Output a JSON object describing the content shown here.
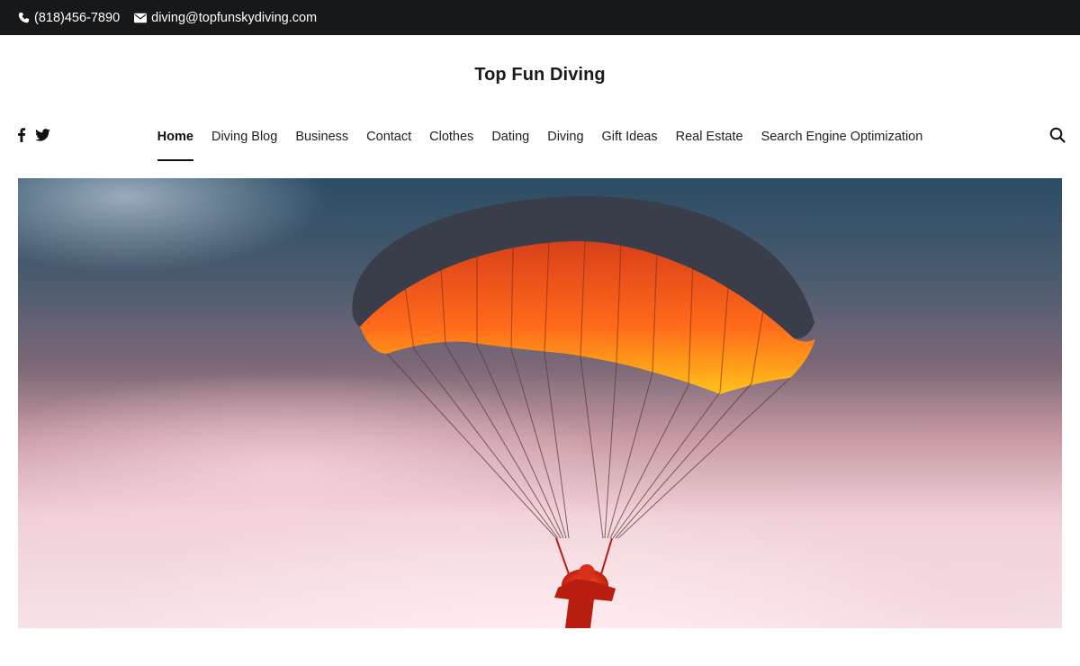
{
  "topbar": {
    "phone": "(818)456-7890",
    "email": "diving@topfunskydiving.com",
    "phone_icon": "phone-icon",
    "email_icon": "envelope-icon"
  },
  "site": {
    "title": "Top Fun Diving"
  },
  "social": [
    {
      "icon": "facebook-icon"
    },
    {
      "icon": "twitter-icon"
    }
  ],
  "nav": {
    "items": [
      {
        "label": "Home",
        "active": true
      },
      {
        "label": "Diving Blog"
      },
      {
        "label": "Business"
      },
      {
        "label": "Contact"
      },
      {
        "label": "Clothes"
      },
      {
        "label": "Dating"
      },
      {
        "label": "Diving"
      },
      {
        "label": "Gift Ideas"
      },
      {
        "label": "Real Estate"
      },
      {
        "label": "Search Engine Optimization"
      }
    ],
    "search_icon": "search-icon"
  },
  "hero": {
    "image": "parachute-image"
  },
  "colors": {
    "topbar_bg": "#17181a",
    "text": "#1a1a1a",
    "canopy_orange": "#ff6a1a",
    "canopy_yellow": "#ffc21a"
  }
}
